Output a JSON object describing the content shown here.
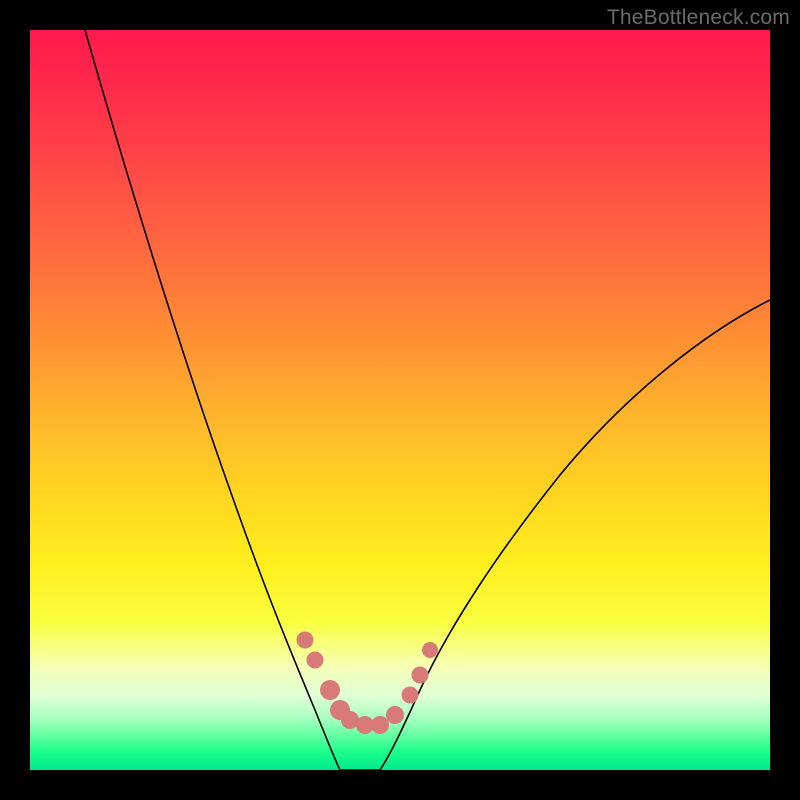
{
  "watermark": "TheBottleneck.com",
  "colors": {
    "background": "#000000",
    "gradient_top": "#ff1a4d",
    "gradient_bottom": "#00e98e",
    "curve": "#000000",
    "bead": "#d87a78"
  },
  "chart_data": {
    "type": "line",
    "title": "",
    "xlabel": "",
    "ylabel": "",
    "xlim": [
      0,
      100
    ],
    "ylim": [
      0,
      100
    ],
    "series": [
      {
        "name": "left-branch",
        "x": [
          7.4,
          10.8,
          14.2,
          17.6,
          20.9,
          24.3,
          27.7,
          31.1,
          32.4,
          34.5,
          37.2,
          38.5,
          39.9,
          41.9
        ],
        "y": [
          100.0,
          86.5,
          73.0,
          60.8,
          50.0,
          39.2,
          29.7,
          18.9,
          14.9,
          9.5,
          4.7,
          2.7,
          1.4,
          0.0
        ]
      },
      {
        "name": "valley-floor",
        "x": [
          41.9,
          44.6,
          47.3
        ],
        "y": [
          0.0,
          0.0,
          0.0
        ]
      },
      {
        "name": "right-branch",
        "x": [
          47.3,
          48.6,
          50.0,
          51.4,
          54.1,
          56.8,
          60.8,
          64.9,
          68.9,
          73.0,
          77.0,
          81.1,
          85.1,
          89.2,
          93.2,
          97.3,
          100.0
        ],
        "y": [
          0.0,
          1.4,
          2.7,
          5.4,
          9.5,
          14.9,
          21.6,
          28.4,
          33.8,
          39.2,
          44.6,
          48.6,
          52.7,
          56.8,
          59.5,
          62.2,
          63.5
        ]
      }
    ],
    "markers": [
      {
        "name": "bead-left-2",
        "x": 37.2,
        "y": 17.6,
        "r": 1.15
      },
      {
        "name": "bead-left-3",
        "x": 38.5,
        "y": 14.9,
        "r": 1.15
      },
      {
        "name": "bead-left-4",
        "x": 40.5,
        "y": 10.8,
        "r": 1.35
      },
      {
        "name": "bead-left-5",
        "x": 41.9,
        "y": 8.1,
        "r": 1.35
      },
      {
        "name": "bead-floor-1",
        "x": 43.2,
        "y": 6.8,
        "r": 1.22
      },
      {
        "name": "bead-floor-2",
        "x": 45.3,
        "y": 6.1,
        "r": 1.22
      },
      {
        "name": "bead-floor-3",
        "x": 47.3,
        "y": 6.1,
        "r": 1.22
      },
      {
        "name": "bead-right-1",
        "x": 49.3,
        "y": 7.4,
        "r": 1.22
      },
      {
        "name": "bead-right-2",
        "x": 51.4,
        "y": 10.1,
        "r": 1.15
      },
      {
        "name": "bead-right-3",
        "x": 52.7,
        "y": 12.8,
        "r": 1.15
      },
      {
        "name": "bead-right-4",
        "x": 54.1,
        "y": 16.2,
        "r": 1.08
      }
    ]
  }
}
